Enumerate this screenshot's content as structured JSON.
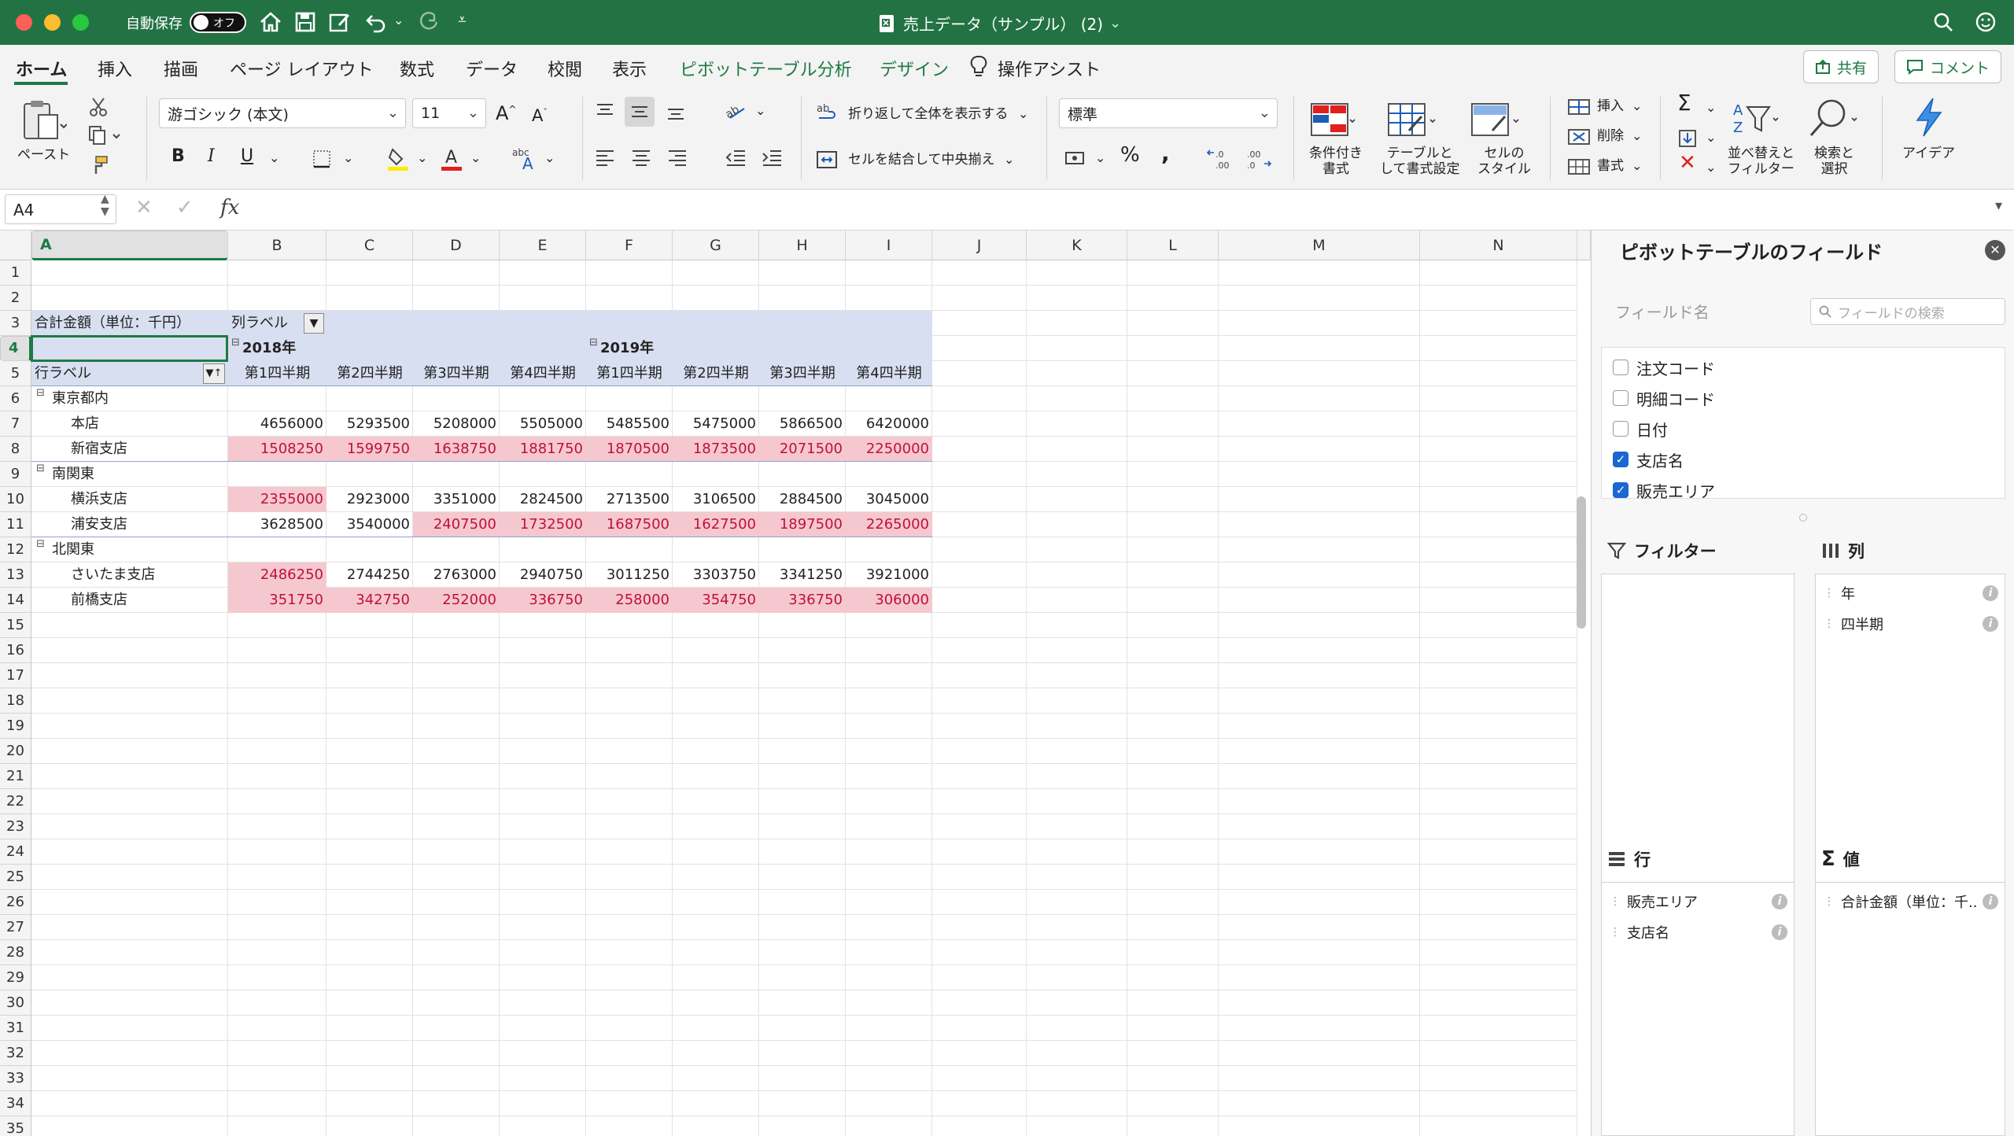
{
  "titlebar": {
    "autosave_label": "自動保存",
    "autosave_state": "オフ",
    "document_title": "売上データ（サンプル） (2)"
  },
  "menu": {
    "tabs": [
      "ホーム",
      "挿入",
      "描画",
      "ページ レイアウト",
      "数式",
      "データ",
      "校閲",
      "表示",
      "ピボットテーブル分析",
      "デザイン",
      "操作アシスト"
    ],
    "share_label": "共有",
    "comment_label": "コメント"
  },
  "ribbon": {
    "paste_label": "ペースト",
    "font_name": "游ゴシック (本文)",
    "font_size": "11",
    "wrap_text_label": "折り返して全体を表示する",
    "merge_center_label": "セルを結合して中央揃え",
    "number_format": "標準",
    "cond_format_label": [
      "条件付き",
      "書式"
    ],
    "table_format_label": [
      "テーブルと",
      "して書式設定"
    ],
    "cell_style_label": [
      "セルの",
      "スタイル"
    ],
    "insert_label": "挿入",
    "delete_label": "削除",
    "format_label": "書式",
    "sort_filter_label": [
      "並べ替えと",
      "フィルター"
    ],
    "find_select_label": [
      "検索と",
      "選択"
    ],
    "ideas_label": "アイデア"
  },
  "formula": {
    "name_box": "A4",
    "fx": "fx"
  },
  "grid": {
    "columns": [
      "A",
      "B",
      "C",
      "D",
      "E",
      "F",
      "G",
      "H",
      "I",
      "J",
      "K",
      "L",
      "M",
      "N"
    ],
    "rows": [
      "1",
      "2",
      "3",
      "4",
      "5",
      "6",
      "7",
      "8",
      "9",
      "10",
      "11",
      "12",
      "13",
      "14",
      "15",
      "16",
      "17",
      "18",
      "19",
      "20",
      "21",
      "22",
      "23",
      "24",
      "25",
      "26",
      "27",
      "28",
      "29",
      "30",
      "31",
      "32",
      "33",
      "34",
      "35"
    ],
    "selected_cell": "A4"
  },
  "pivot": {
    "value_header": "合計金額（単位：千円）",
    "column_labels": "列ラベル",
    "row_labels": "行ラベル",
    "years": [
      "2018年",
      "2019年"
    ],
    "quarters": [
      "第1四半期",
      "第2四半期",
      "第3四半期",
      "第4四半期",
      "第1四半期",
      "第2四半期",
      "第3四半期",
      "第4四半期"
    ],
    "groups": [
      {
        "name": "東京都内",
        "stores": [
          {
            "name": "本店",
            "values": [
              "4656000",
              "5293500",
              "5208000",
              "5505000",
              "5485500",
              "5475000",
              "5866500",
              "6420000"
            ],
            "highlight": [
              false,
              false,
              false,
              false,
              false,
              false,
              false,
              false
            ]
          },
          {
            "name": "新宿支店",
            "values": [
              "1508250",
              "1599750",
              "1638750",
              "1881750",
              "1870500",
              "1873500",
              "2071500",
              "2250000"
            ],
            "highlight": [
              true,
              true,
              true,
              true,
              true,
              true,
              true,
              true
            ]
          }
        ]
      },
      {
        "name": "南関東",
        "stores": [
          {
            "name": "横浜支店",
            "values": [
              "2355000",
              "2923000",
              "3351000",
              "2824500",
              "2713500",
              "3106500",
              "2884500",
              "3045000"
            ],
            "highlight": [
              true,
              false,
              false,
              false,
              false,
              false,
              false,
              false
            ]
          },
          {
            "name": "浦安支店",
            "values": [
              "3628500",
              "3540000",
              "2407500",
              "1732500",
              "1687500",
              "1627500",
              "1897500",
              "2265000"
            ],
            "highlight": [
              false,
              false,
              true,
              true,
              true,
              true,
              true,
              true
            ]
          }
        ]
      },
      {
        "name": "北関東",
        "stores": [
          {
            "name": "さいたま支店",
            "values": [
              "2486250",
              "2744250",
              "2763000",
              "2940750",
              "3011250",
              "3303750",
              "3341250",
              "3921000"
            ],
            "highlight": [
              true,
              false,
              false,
              false,
              false,
              false,
              false,
              false
            ]
          },
          {
            "name": "前橋支店",
            "values": [
              "351750",
              "342750",
              "252000",
              "336750",
              "258000",
              "354750",
              "336750",
              "306000"
            ],
            "highlight": [
              true,
              true,
              true,
              true,
              true,
              true,
              true,
              true
            ]
          }
        ]
      }
    ]
  },
  "pane": {
    "title": "ピボットテーブルのフィールド",
    "field_name_label": "フィールド名",
    "search_placeholder": "フィールドの検索",
    "fields": [
      {
        "name": "注文コード",
        "checked": false
      },
      {
        "name": "明細コード",
        "checked": false
      },
      {
        "name": "日付",
        "checked": false
      },
      {
        "name": "支店名",
        "checked": true
      },
      {
        "name": "販売エリア",
        "checked": true
      }
    ],
    "filter_label": "フィルター",
    "columns_label": "列",
    "rows_label": "行",
    "values_label": "値",
    "column_items": [
      "年",
      "四半期"
    ],
    "row_items": [
      "販売エリア",
      "支店名"
    ],
    "value_items": [
      "合計金額（単位：千..."
    ]
  },
  "colors": {
    "titlebar": "#237244",
    "accent": "#1e7a44",
    "pivot_band": "#d8dff0",
    "highlight_bg": "#f5c8d0",
    "highlight_text": "#c0103a"
  }
}
